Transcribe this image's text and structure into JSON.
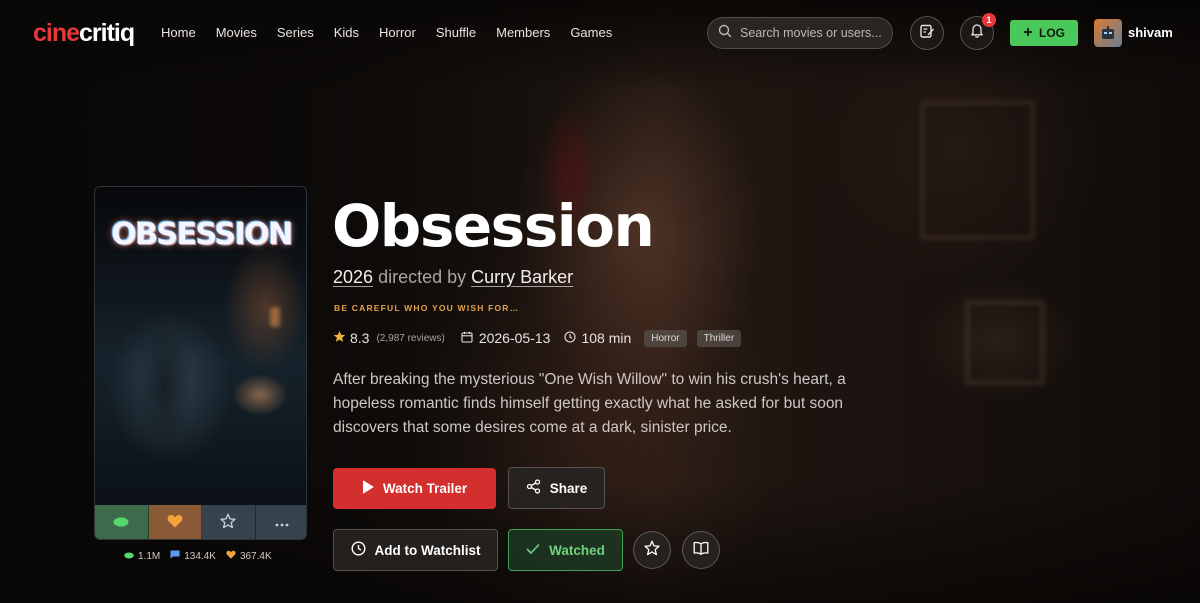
{
  "brand": {
    "logo_part1": "cine",
    "logo_part2": "critiq",
    "accent": "#e5383b"
  },
  "nav": {
    "items": [
      "Home",
      "Movies",
      "Series",
      "Kids",
      "Horror",
      "Shuffle",
      "Members",
      "Games"
    ]
  },
  "search": {
    "placeholder": "Search movies or users..."
  },
  "header": {
    "notification_count": "1",
    "log_label": "LOG",
    "username": "shivam",
    "icons": [
      "search-icon",
      "edit-note-icon",
      "bell-icon",
      "plus-icon"
    ]
  },
  "poster": {
    "title": "OBSESSION",
    "actions": [
      "seen-eye-icon",
      "heart-icon",
      "star-icon",
      "more-icon"
    ],
    "stats": {
      "views": "1.1M",
      "reviews": "134.4K",
      "likes": "367.4K"
    }
  },
  "movie": {
    "title": "Obsession",
    "year": "2026",
    "directed_by_label": "directed by",
    "director": "Curry Barker",
    "tagline": "BE CAREFUL WHO YOU WISH FOR…",
    "rating": "8.3",
    "reviews": "(2,987 reviews)",
    "release_date": "2026-05-13",
    "runtime": "108 min",
    "genres": [
      "Horror",
      "Thriller"
    ],
    "synopsis": "After breaking the mysterious \"One Wish Willow\" to win his crush's heart, a hopeless romantic finds himself getting exactly what he asked for but soon discovers that some desires come at a dark, sinister price."
  },
  "actions": {
    "watch_trailer": "Watch Trailer",
    "share": "Share",
    "add_to_watchlist": "Add to Watchlist",
    "watched": "Watched"
  },
  "colors": {
    "trailer_red": "#d32f2f",
    "log_green": "#4ac95a",
    "watched_green": "#6fd17c",
    "tagline_orange": "#e6a24a",
    "star_gold": "#f1b33f"
  }
}
